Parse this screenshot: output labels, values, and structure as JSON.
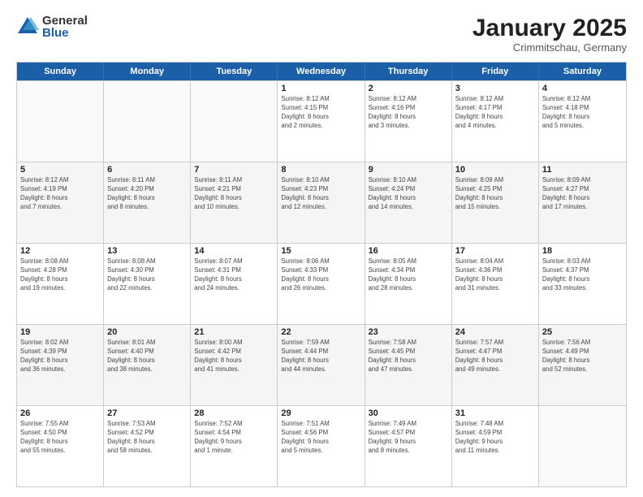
{
  "logo": {
    "general": "General",
    "blue": "Blue"
  },
  "title": "January 2025",
  "subtitle": "Crimmitschau, Germany",
  "headers": [
    "Sunday",
    "Monday",
    "Tuesday",
    "Wednesday",
    "Thursday",
    "Friday",
    "Saturday"
  ],
  "rows": [
    [
      {
        "day": "",
        "text": "",
        "empty": true
      },
      {
        "day": "",
        "text": "",
        "empty": true
      },
      {
        "day": "",
        "text": "",
        "empty": true
      },
      {
        "day": "1",
        "text": "Sunrise: 8:12 AM\nSunset: 4:15 PM\nDaylight: 8 hours\nand 2 minutes."
      },
      {
        "day": "2",
        "text": "Sunrise: 8:12 AM\nSunset: 4:16 PM\nDaylight: 8 hours\nand 3 minutes."
      },
      {
        "day": "3",
        "text": "Sunrise: 8:12 AM\nSunset: 4:17 PM\nDaylight: 8 hours\nand 4 minutes."
      },
      {
        "day": "4",
        "text": "Sunrise: 8:12 AM\nSunset: 4:18 PM\nDaylight: 8 hours\nand 5 minutes."
      }
    ],
    [
      {
        "day": "5",
        "text": "Sunrise: 8:12 AM\nSunset: 4:19 PM\nDaylight: 8 hours\nand 7 minutes."
      },
      {
        "day": "6",
        "text": "Sunrise: 8:11 AM\nSunset: 4:20 PM\nDaylight: 8 hours\nand 8 minutes."
      },
      {
        "day": "7",
        "text": "Sunrise: 8:11 AM\nSunset: 4:21 PM\nDaylight: 8 hours\nand 10 minutes."
      },
      {
        "day": "8",
        "text": "Sunrise: 8:10 AM\nSunset: 4:23 PM\nDaylight: 8 hours\nand 12 minutes."
      },
      {
        "day": "9",
        "text": "Sunrise: 8:10 AM\nSunset: 4:24 PM\nDaylight: 8 hours\nand 14 minutes."
      },
      {
        "day": "10",
        "text": "Sunrise: 8:09 AM\nSunset: 4:25 PM\nDaylight: 8 hours\nand 15 minutes."
      },
      {
        "day": "11",
        "text": "Sunrise: 8:09 AM\nSunset: 4:27 PM\nDaylight: 8 hours\nand 17 minutes."
      }
    ],
    [
      {
        "day": "12",
        "text": "Sunrise: 8:08 AM\nSunset: 4:28 PM\nDaylight: 8 hours\nand 19 minutes."
      },
      {
        "day": "13",
        "text": "Sunrise: 8:08 AM\nSunset: 4:30 PM\nDaylight: 8 hours\nand 22 minutes."
      },
      {
        "day": "14",
        "text": "Sunrise: 8:07 AM\nSunset: 4:31 PM\nDaylight: 8 hours\nand 24 minutes."
      },
      {
        "day": "15",
        "text": "Sunrise: 8:06 AM\nSunset: 4:33 PM\nDaylight: 8 hours\nand 26 minutes."
      },
      {
        "day": "16",
        "text": "Sunrise: 8:05 AM\nSunset: 4:34 PM\nDaylight: 8 hours\nand 28 minutes."
      },
      {
        "day": "17",
        "text": "Sunrise: 8:04 AM\nSunset: 4:36 PM\nDaylight: 8 hours\nand 31 minutes."
      },
      {
        "day": "18",
        "text": "Sunrise: 8:03 AM\nSunset: 4:37 PM\nDaylight: 8 hours\nand 33 minutes."
      }
    ],
    [
      {
        "day": "19",
        "text": "Sunrise: 8:02 AM\nSunset: 4:39 PM\nDaylight: 8 hours\nand 36 minutes."
      },
      {
        "day": "20",
        "text": "Sunrise: 8:01 AM\nSunset: 4:40 PM\nDaylight: 8 hours\nand 38 minutes."
      },
      {
        "day": "21",
        "text": "Sunrise: 8:00 AM\nSunset: 4:42 PM\nDaylight: 8 hours\nand 41 minutes."
      },
      {
        "day": "22",
        "text": "Sunrise: 7:59 AM\nSunset: 4:44 PM\nDaylight: 8 hours\nand 44 minutes."
      },
      {
        "day": "23",
        "text": "Sunrise: 7:58 AM\nSunset: 4:45 PM\nDaylight: 8 hours\nand 47 minutes."
      },
      {
        "day": "24",
        "text": "Sunrise: 7:57 AM\nSunset: 4:47 PM\nDaylight: 8 hours\nand 49 minutes."
      },
      {
        "day": "25",
        "text": "Sunrise: 7:56 AM\nSunset: 4:49 PM\nDaylight: 8 hours\nand 52 minutes."
      }
    ],
    [
      {
        "day": "26",
        "text": "Sunrise: 7:55 AM\nSunset: 4:50 PM\nDaylight: 8 hours\nand 55 minutes."
      },
      {
        "day": "27",
        "text": "Sunrise: 7:53 AM\nSunset: 4:52 PM\nDaylight: 8 hours\nand 58 minutes."
      },
      {
        "day": "28",
        "text": "Sunrise: 7:52 AM\nSunset: 4:54 PM\nDaylight: 9 hours\nand 1 minute."
      },
      {
        "day": "29",
        "text": "Sunrise: 7:51 AM\nSunset: 4:56 PM\nDaylight: 9 hours\nand 5 minutes."
      },
      {
        "day": "30",
        "text": "Sunrise: 7:49 AM\nSunset: 4:57 PM\nDaylight: 9 hours\nand 8 minutes."
      },
      {
        "day": "31",
        "text": "Sunrise: 7:48 AM\nSunset: 4:59 PM\nDaylight: 9 hours\nand 11 minutes."
      },
      {
        "day": "",
        "text": "",
        "empty": true
      }
    ]
  ]
}
